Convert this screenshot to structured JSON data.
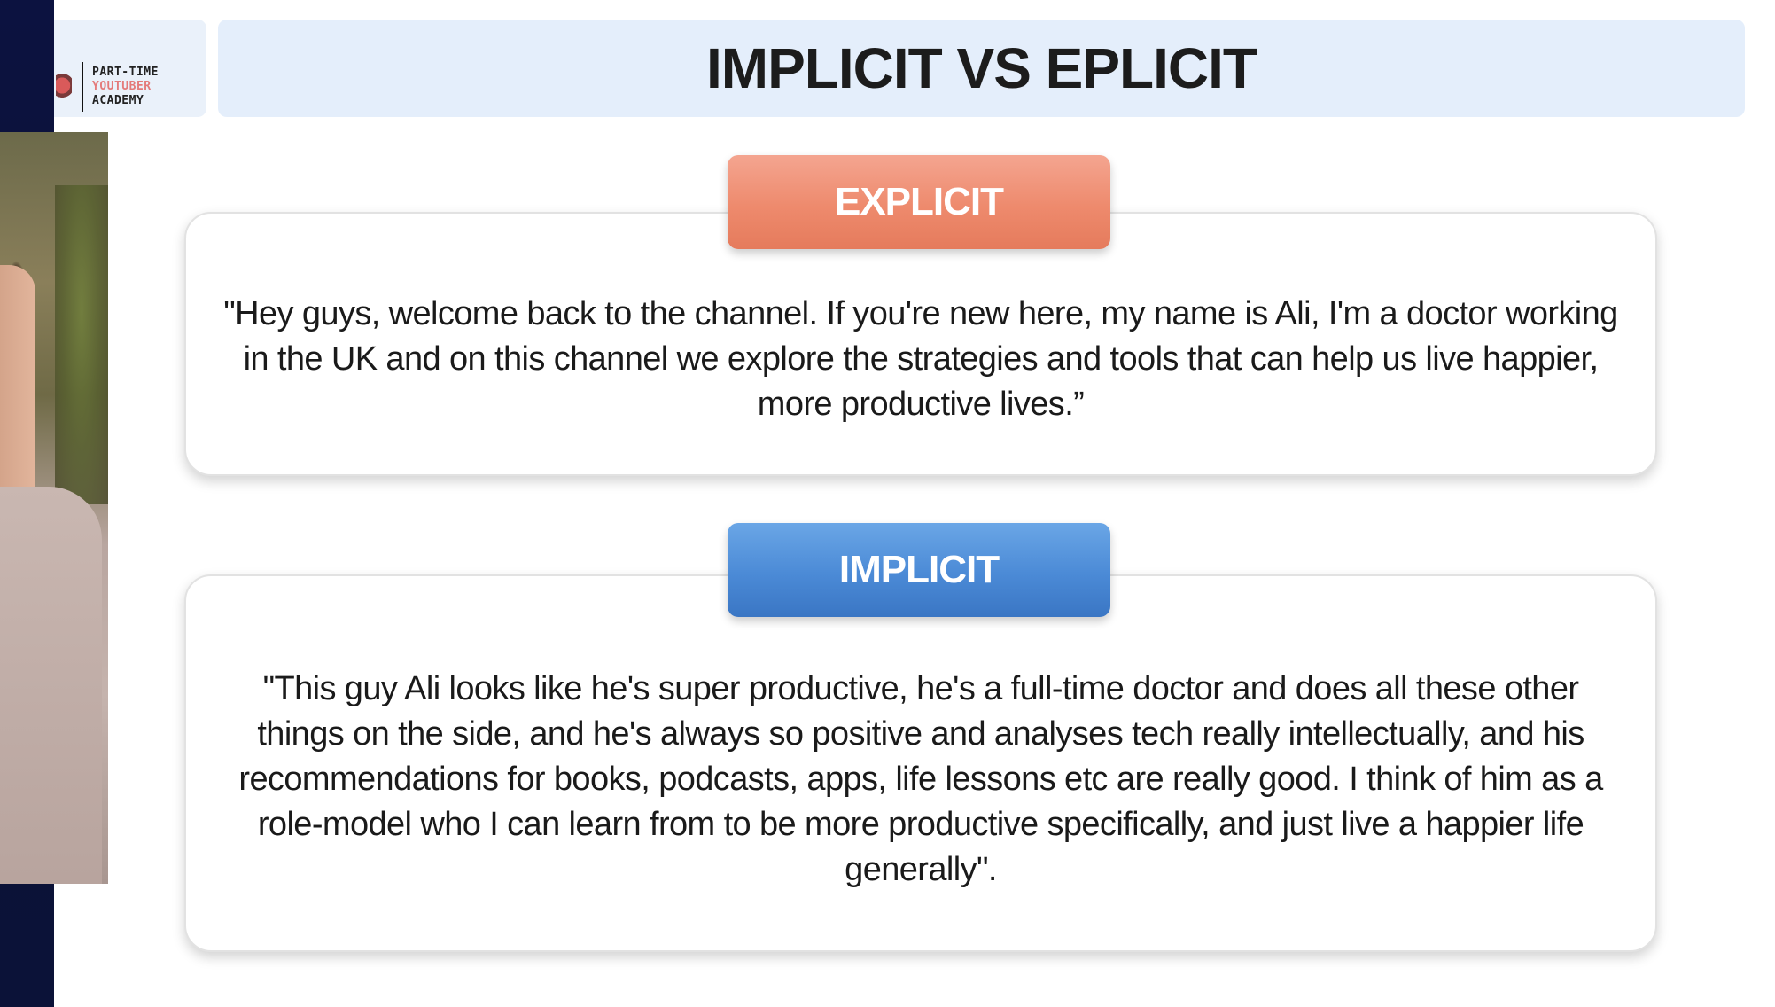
{
  "logo": {
    "line1": "PART-TIME",
    "line2": "YOUTUBER",
    "line3": "ACADEMY"
  },
  "slide": {
    "title": "IMPLICIT VS EPLICIT"
  },
  "explicit": {
    "label": "EXPLICIT",
    "quote": "\"Hey guys, welcome back to the channel. If you're new here, my name is Ali, I'm a doctor working in the UK and on this channel we explore the strategies and tools that can help us live happier, more productive lives.”",
    "color": "#ee8a6d"
  },
  "implicit": {
    "label": "IMPLICIT",
    "quote": "\"This guy Ali looks like he's super productive, he's a full-time doctor and does all these other things on the side, and he's always so positive and analyses tech really intellectually, and his recommendations for books, podcasts, apps, life lessons etc are really good. I think of him as a role-model who I can learn from to be more productive specifically, and just live a happier life generally\".",
    "color": "#4b8ad6"
  },
  "colors": {
    "left_strip": "#0c1240",
    "title_bar": "#e4eefb"
  }
}
